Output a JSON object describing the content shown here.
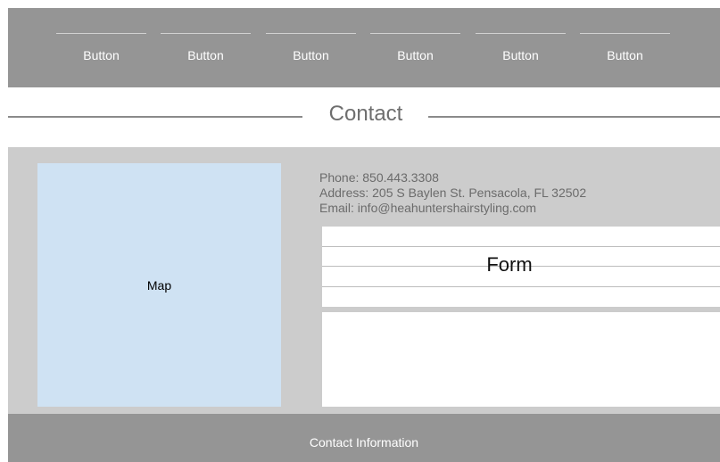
{
  "nav": {
    "buttons": [
      "Button",
      "Button",
      "Button",
      "Button",
      "Button",
      "Button"
    ]
  },
  "heading": {
    "title": "Contact"
  },
  "map": {
    "label": "Map"
  },
  "contact_info": {
    "phone": "Phone: 850.443.3308",
    "address": "Address: 205 S Baylen St. Pensacola, FL 32502",
    "email": "Email: info@heahuntershairstyling.com"
  },
  "form": {
    "title": "Form"
  },
  "footer": {
    "label": "Contact Information"
  }
}
